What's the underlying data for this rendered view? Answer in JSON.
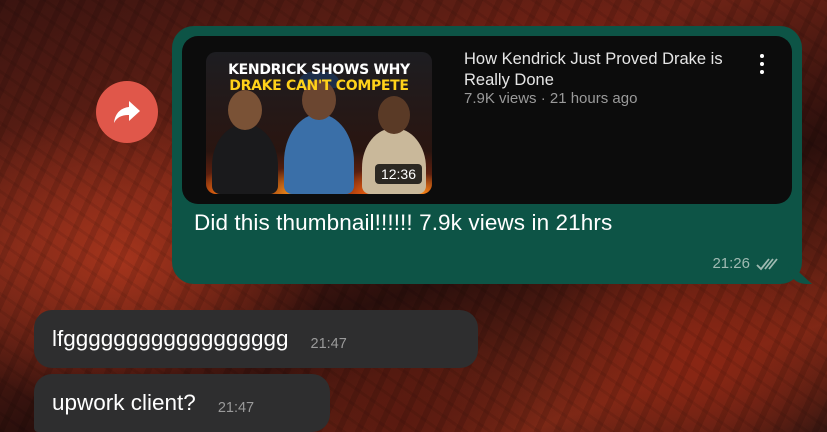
{
  "forward_icon": "forward-arrow-icon",
  "outgoing": {
    "link_preview": {
      "thumbnail_headline_line1": "KENDRICK SHOWS WHY",
      "thumbnail_headline_line2": "DRAKE CAN'T COMPETE",
      "duration": "12:36",
      "title": "How Kendrick Just Proved Drake is Really Done",
      "meta": "7.9K views · 21 hours ago"
    },
    "text": "Did this thumbnail!!!!!! 7.9k views in 21hrs",
    "time": "21:26",
    "status_icon": "double-check-icon"
  },
  "incoming": [
    {
      "text": "lfgggggggggggggggggg",
      "time": "21:47"
    },
    {
      "text": "upwork client?",
      "time": "21:47"
    }
  ],
  "colors": {
    "outgoing_bubble": "#0d5446",
    "incoming_bubble": "#2e2e2f",
    "forward_button": "#e0574a",
    "preview_card": "#0c0c0c",
    "thumbnail_accent": "#ffd21a"
  }
}
